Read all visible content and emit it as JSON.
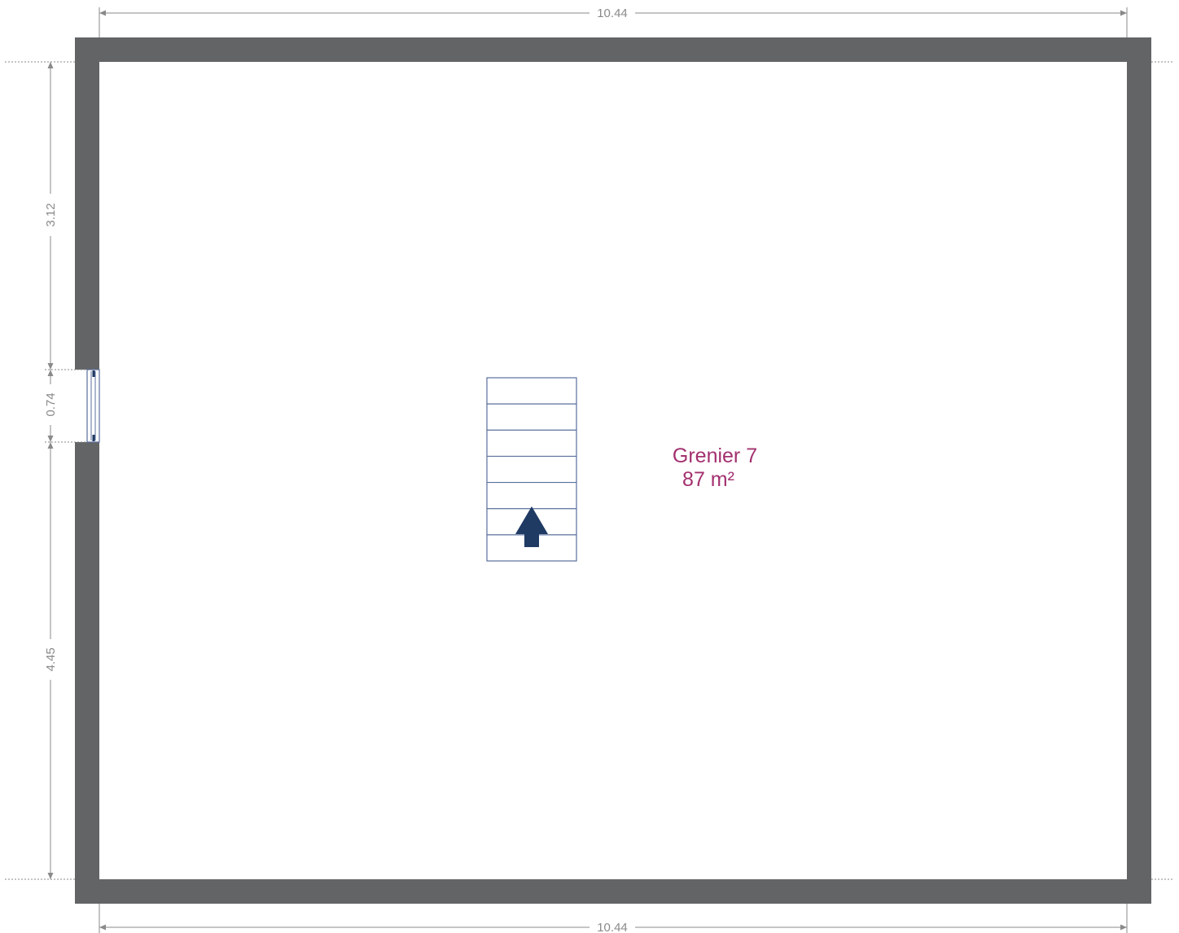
{
  "plan": {
    "room": {
      "name": "Grenier 7",
      "area": "87 m²"
    },
    "dimensions": {
      "top_width": "10.44",
      "bottom_width": "10.44",
      "left_upper": "3.12",
      "left_window": "0.74",
      "left_lower": "4.45"
    },
    "staircase": {
      "steps": 7,
      "direction": "up"
    },
    "colors": {
      "wall": "#636466",
      "dimension_line": "#8a8a8a",
      "dimension_text": "#8a8a8a",
      "room_label": "#a3306f",
      "stair_line": "#5a6f9c",
      "stair_arrow": "#1f3a63",
      "window": "#5a6f9c"
    }
  }
}
